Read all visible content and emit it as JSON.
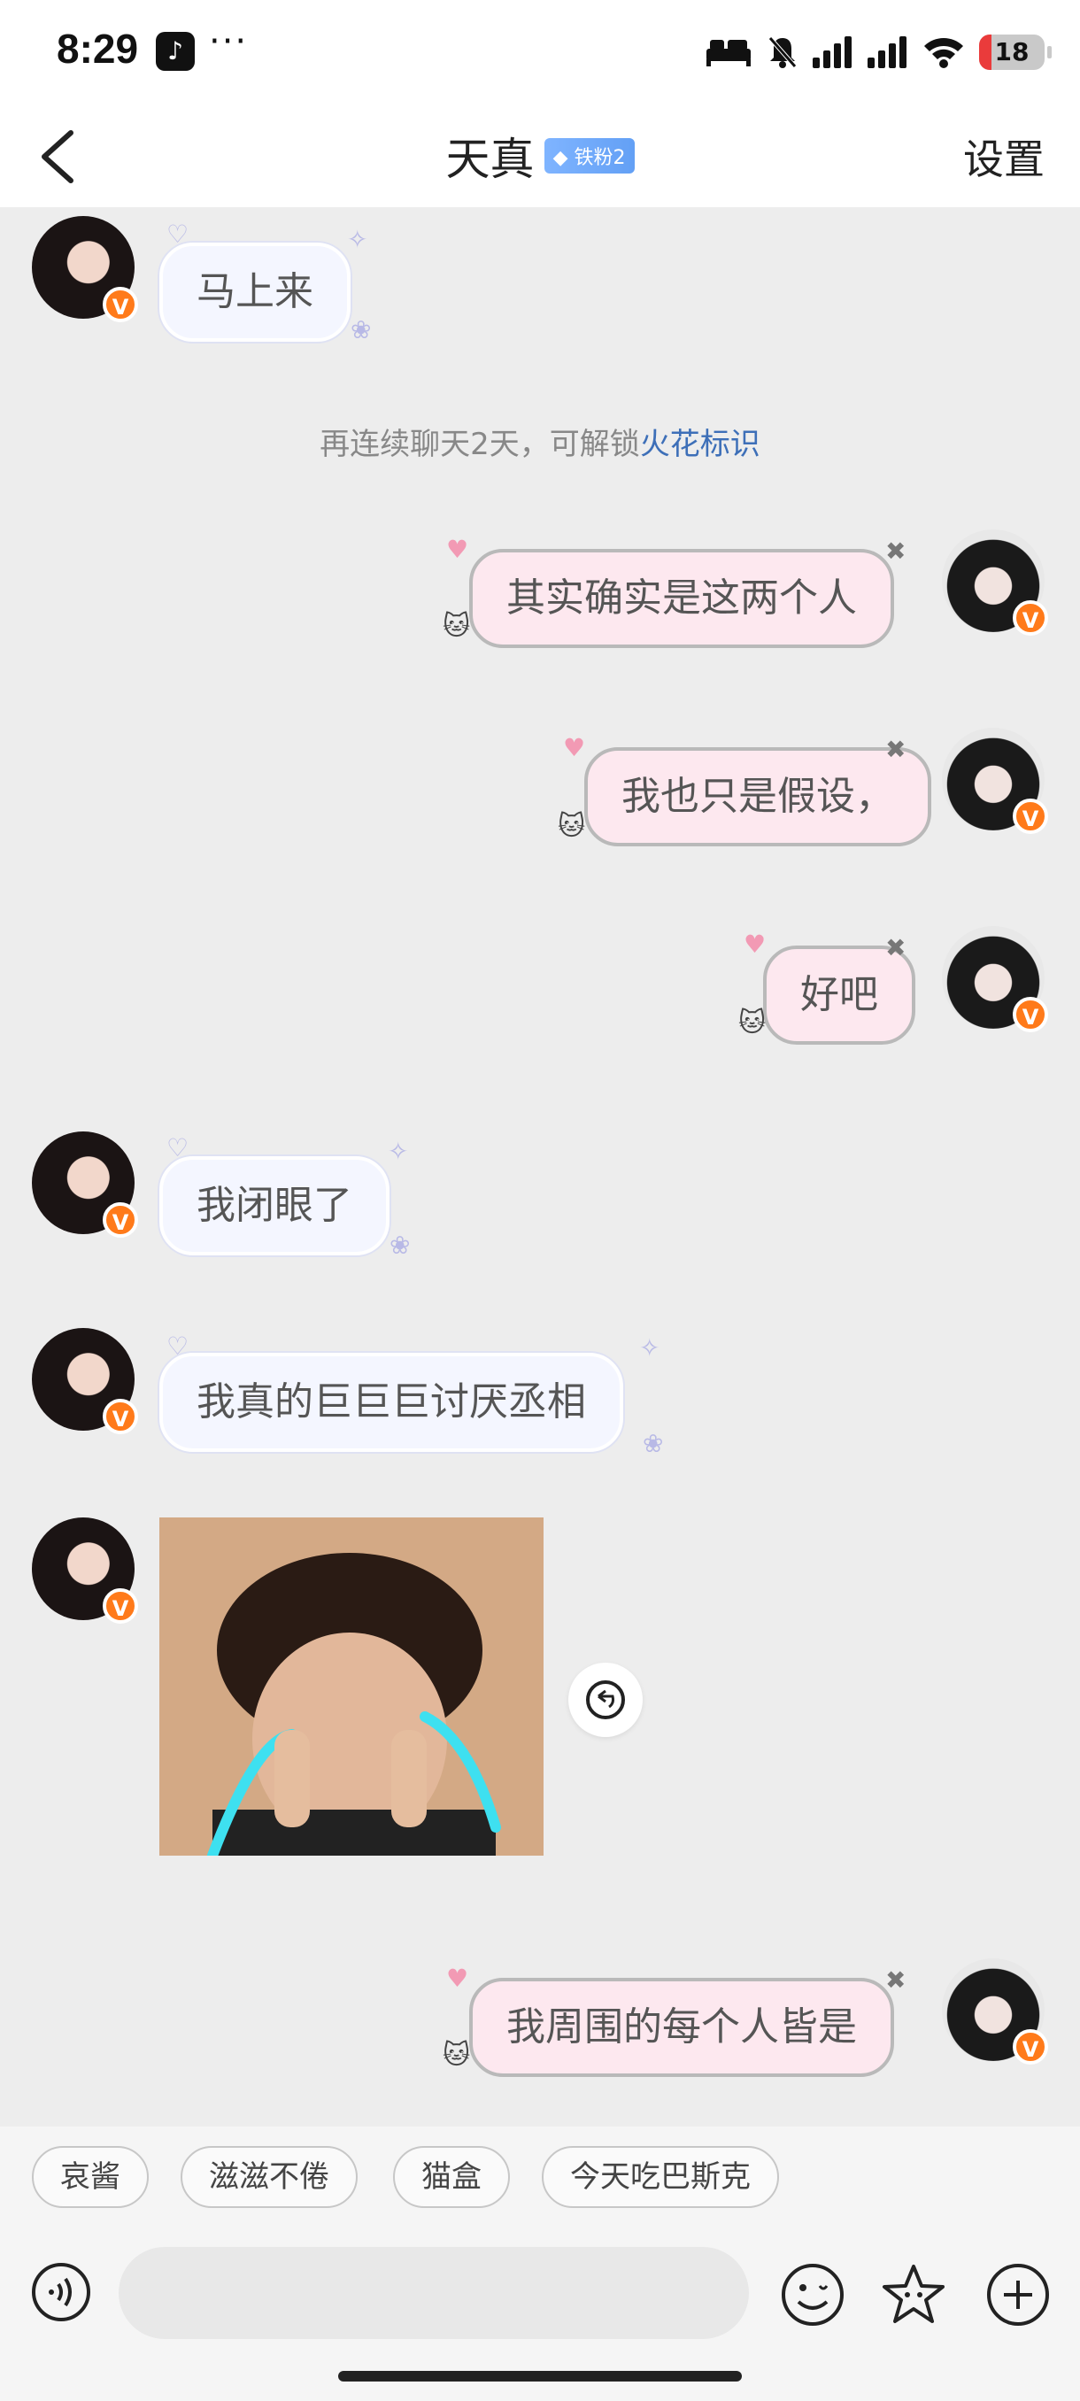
{
  "status_bar": {
    "time": "8:29",
    "dots": "···",
    "battery": "18",
    "icons": [
      "tiktok-icon",
      "bed-icon",
      "mute-icon",
      "signal-icon",
      "signal-icon-2",
      "wifi-icon",
      "battery-icon"
    ]
  },
  "header": {
    "back_icon": "chevron-left-icon",
    "title": "天真",
    "badge": "铁粉2",
    "settings": "设置"
  },
  "messages": [
    {
      "side": "in",
      "text": "马上来"
    },
    {
      "side": "out",
      "text": "其实确实是这两个人"
    },
    {
      "side": "out",
      "text": "我也只是假设，"
    },
    {
      "side": "out",
      "text": "好吧"
    },
    {
      "side": "in",
      "text": "我闭眼了"
    },
    {
      "side": "in",
      "text": "我真的巨巨巨讨厌丞相"
    },
    {
      "side": "in",
      "type": "image",
      "text": ""
    },
    {
      "side": "out",
      "text": "我周围的每个人皆是"
    }
  ],
  "system_tip": {
    "prefix": "再连续聊天2天，可解锁",
    "link": "火花标识"
  },
  "quick_replies": [
    "哀酱",
    "滋滋不倦",
    "猫盒",
    "今天吃巴斯克"
  ],
  "input": {
    "placeholder": "",
    "value": ""
  },
  "colors": {
    "accent_link": "#3d6fb8",
    "badge_blue": "#6aa6f7",
    "verified_orange": "#ff7a1a",
    "outgoing_bubble": "#fde8ef",
    "incoming_bubble": "#f4f6ff"
  }
}
